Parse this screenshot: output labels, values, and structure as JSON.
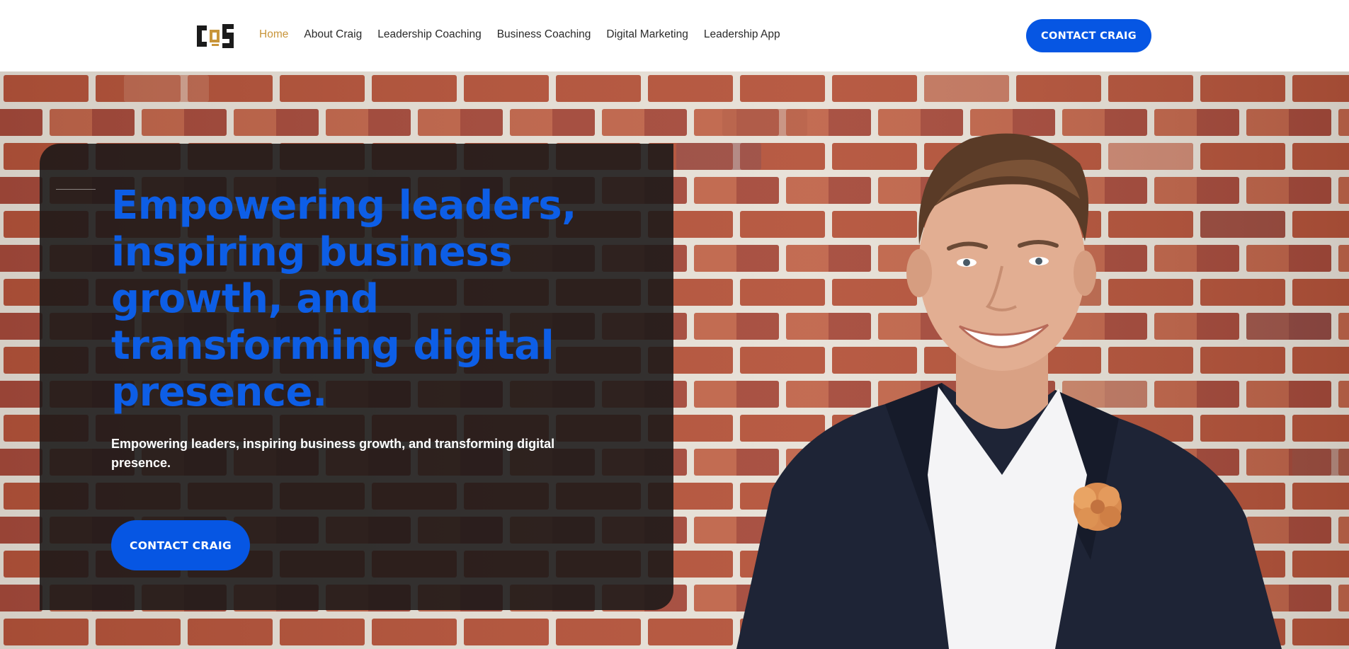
{
  "header": {
    "logo_text": "CQS",
    "nav": [
      {
        "label": "Home",
        "active": true
      },
      {
        "label": "About Craig",
        "active": false
      },
      {
        "label": "Leadership Coaching",
        "active": false
      },
      {
        "label": "Business Coaching",
        "active": false
      },
      {
        "label": "Digital Marketing",
        "active": false
      },
      {
        "label": "Leadership App",
        "active": false
      }
    ],
    "cta_label": "CONTACT CRAIG"
  },
  "hero": {
    "title": "Empowering leaders, inspiring business growth, and transforming digital presence.",
    "subtitle": "Empowering leaders, inspiring business growth, and transforming digital presence.",
    "cta_label": "CONTACT CRAIG"
  },
  "colors": {
    "accent_blue": "#0656e3",
    "title_blue": "#0d5ee6",
    "active_nav_gold": "#c8953a",
    "card_dark": "#1a1818",
    "brick": "#b2694f"
  },
  "icons": {
    "logo": "cqs-logo-icon"
  }
}
